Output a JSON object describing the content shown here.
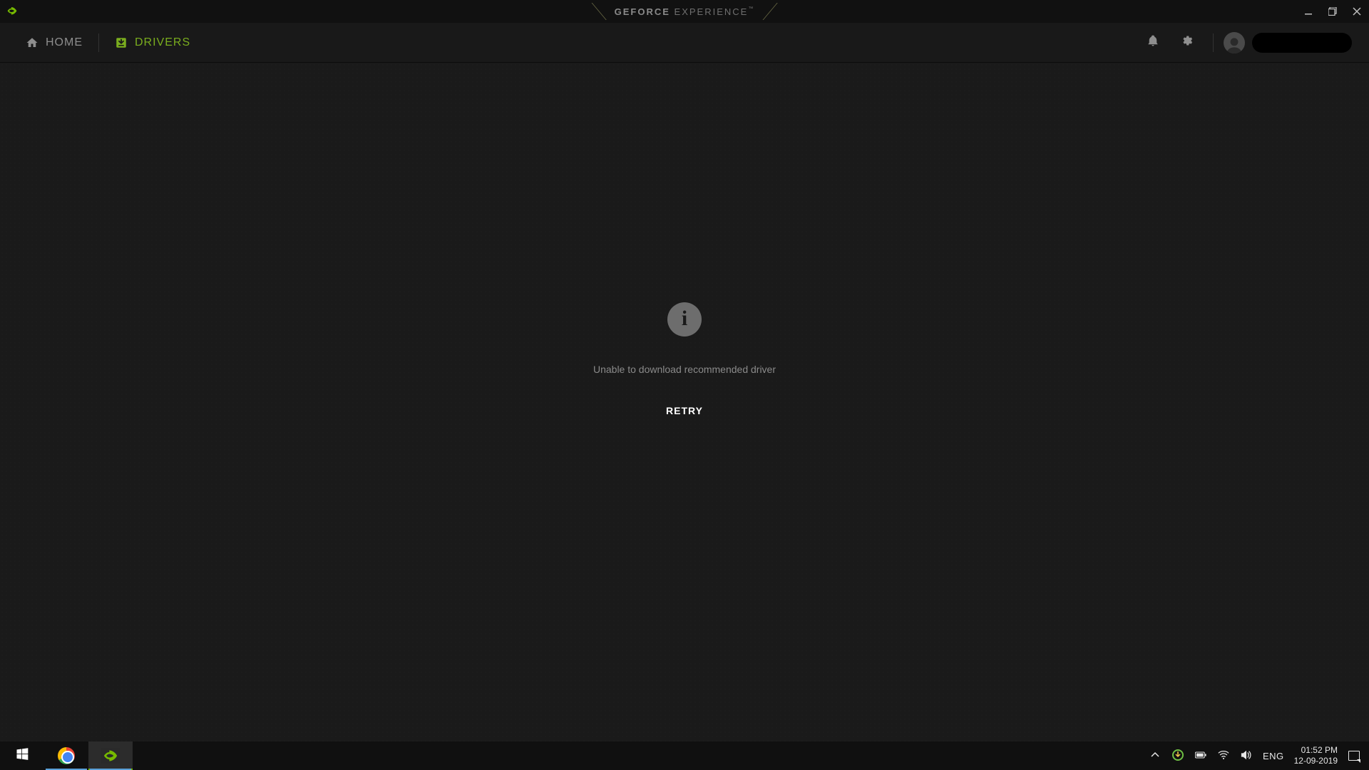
{
  "brand": {
    "bold": "GEFORCE",
    "light": " EXPERIENCE",
    "tm": "™"
  },
  "nav": {
    "home": "HOME",
    "drivers": "DRIVERS"
  },
  "message": {
    "text": "Unable to download recommended driver",
    "retry": "RETRY"
  },
  "taskbar": {
    "lang": "ENG",
    "time": "01:52 PM",
    "date": "12-09-2019"
  },
  "colors": {
    "accent": "#76b900"
  }
}
